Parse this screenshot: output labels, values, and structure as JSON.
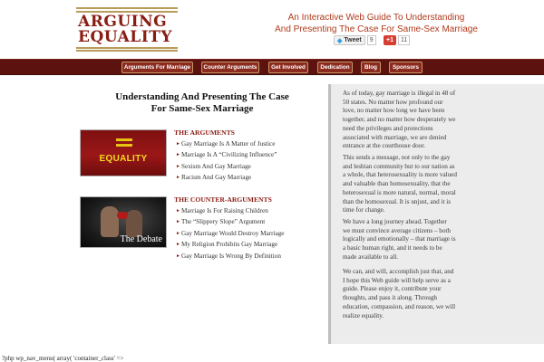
{
  "header": {
    "logo_line1": "ARGUING",
    "logo_line2": "EQUALITY",
    "tagline_line1": "An Interactive Web Guide To Understanding",
    "tagline_line2": "And Presenting The Case For Same-Sex Marriage",
    "tweet_label": "Tweet",
    "tweet_count": "9",
    "gplus_label": "+1",
    "gplus_count": "11"
  },
  "nav": {
    "items": [
      {
        "label": "Arguments For Marriage"
      },
      {
        "label": "Counter Arguments"
      },
      {
        "label": "Get Involved"
      },
      {
        "label": "Dedication"
      },
      {
        "label": "Blog"
      },
      {
        "label": "Sponsors"
      }
    ]
  },
  "main": {
    "title_line1": "Understanding And Presenting The Case",
    "title_line2": "For Same-Sex Marriage",
    "equality_image_text": "EQUALITY",
    "debate_image_text": "The Debate",
    "arguments": {
      "heading": "THE ARGUMENTS",
      "items": [
        "Gay Marriage Is A Matter of Justice",
        "Marriage Is A “Civilizing Influence”",
        "Sexism And Gay Marriage",
        "Racism And Gay Marriage"
      ]
    },
    "counter_arguments": {
      "heading": "THE COUNTER-ARGUMENTS",
      "items": [
        "Marriage Is For Raising Children",
        "The “Slippery Slope” Argument",
        "Gay Marriage Would Destroy Marriage",
        "My Religion Prohibits Gay Marriage",
        "Gay Marriage Is Wrong By Definition"
      ]
    }
  },
  "sidebar": {
    "paragraphs": [
      {
        "lines": [
          "As of today, gay marriage is illegal in 48 of",
          "50 states. No matter how profound our",
          "love, no matter how long we have been",
          "together, and no matter how desperately we",
          "need the privileges and protections",
          "associated with marriage, we are denied",
          "entrance at the courthouse door."
        ]
      },
      {
        "lines": [
          "This sends a message, not only to the gay",
          "and lesbian community but to our nation as",
          "a whole, that heterosexuality is more valued",
          "and valuable than homosexuality, that the",
          "heterosexual is more natural, normal, moral",
          "than the homosexual. It is unjust, and it is",
          "time for change."
        ]
      },
      {
        "lines": [
          "We have a long journey ahead. Together",
          "we must convince average citizens – both",
          "logically and emotionally – that marriage is",
          "a basic human right, and it needs to be",
          "made available to all."
        ]
      },
      {
        "lines": [
          "We can, and will, accomplish just that, and",
          "I hope this Web guide will help serve as a",
          "guide. Please enjoy it, contribute your",
          "thoughts, and pass it along. Through",
          "education, compassion, and reason, we will",
          "realize equality."
        ]
      }
    ]
  },
  "footer": {
    "debug_text": "?php wp_nav_menu( array( 'container_class' =>"
  },
  "colors": {
    "brand_red": "#8a1d13",
    "nav_bg": "#5c1310",
    "tagline": "#b13a1c",
    "sidebar_bg": "#ececec"
  }
}
